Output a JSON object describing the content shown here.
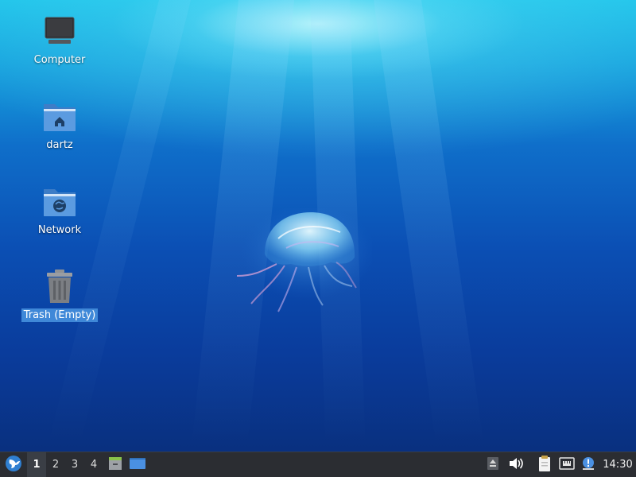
{
  "desktop": {
    "icons": [
      {
        "label": "Computer",
        "icon": "computer-icon"
      },
      {
        "label": "dartz",
        "icon": "home-folder-icon"
      },
      {
        "label": "Network",
        "icon": "network-folder-icon"
      },
      {
        "label": "Trash (Empty)",
        "icon": "trash-icon",
        "selected": true
      }
    ]
  },
  "panel": {
    "workspaces": [
      "1",
      "2",
      "3",
      "4"
    ],
    "active_workspace": "1",
    "launchers": [
      "file-manager-icon",
      "show-desktop-icon"
    ],
    "tray": [
      "eject-icon",
      "volume-icon",
      "clipboard-icon",
      "network-icon",
      "notification-icon"
    ],
    "clock": "14:30"
  },
  "colors": {
    "panel_bg": "#2b2d32",
    "selection": "#3f88d8",
    "accent": "#4a90e2"
  }
}
